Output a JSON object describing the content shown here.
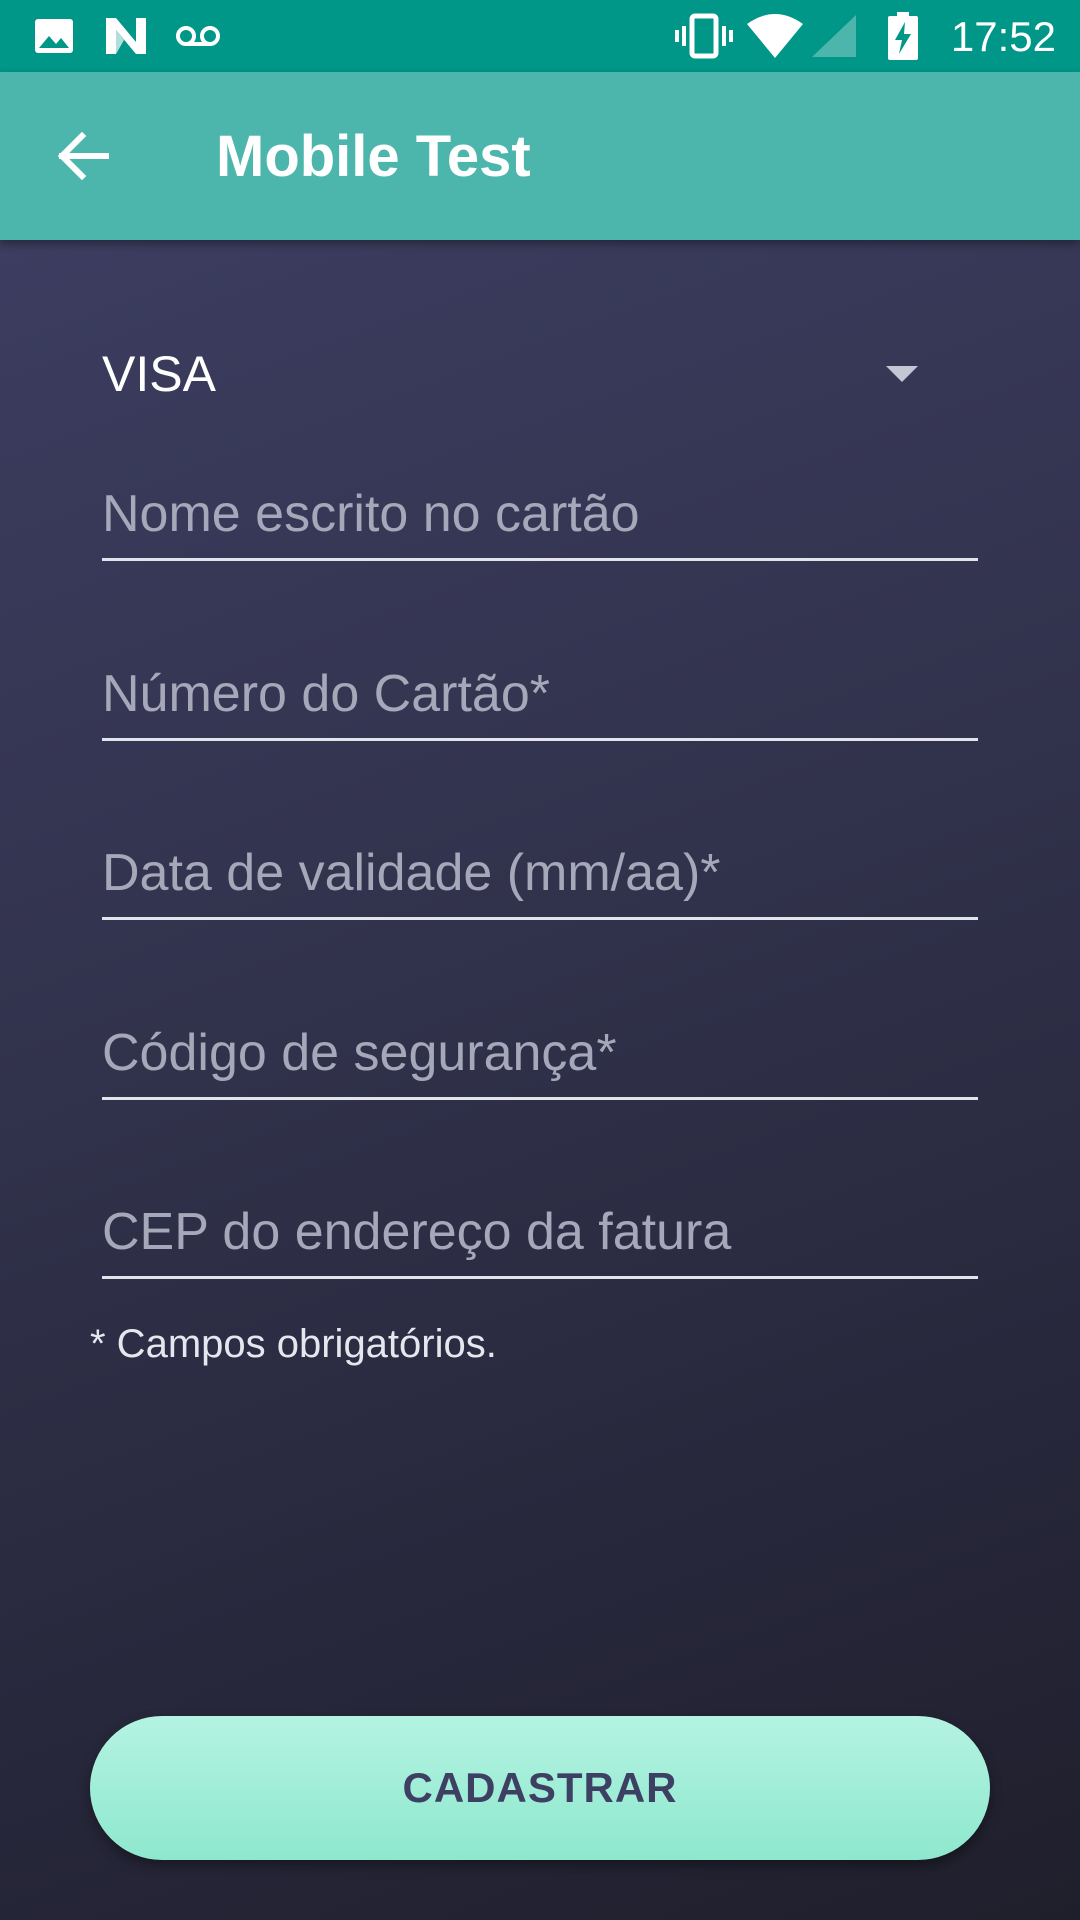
{
  "status_bar": {
    "time": "17:52",
    "left_icons": [
      "image-icon",
      "n-notification-icon",
      "voicemail-icon"
    ],
    "right_icons": [
      "vibrate-icon",
      "wifi-icon",
      "cell-signal-icon",
      "battery-charging-icon"
    ]
  },
  "app_bar": {
    "title": "Mobile Test",
    "back_icon": "arrow-back-icon"
  },
  "form": {
    "card_type": {
      "selected": "VISA",
      "icon": "dropdown-arrow-icon"
    },
    "fields": [
      {
        "placeholder": "Nome escrito no cartão",
        "value": ""
      },
      {
        "placeholder": "Número do Cartão*",
        "value": ""
      },
      {
        "placeholder": "Data de validade (mm/aa)*",
        "value": ""
      },
      {
        "placeholder": "Código de segurança*",
        "value": ""
      },
      {
        "placeholder": "CEP do endereço da fatura",
        "value": ""
      }
    ],
    "required_note": "* Campos obrigatórios.",
    "submit_label": "CADASTRAR"
  },
  "colors": {
    "status_bar": "#009688",
    "app_bar": "#4db6ac",
    "background_top": "#3c3d60",
    "background_bottom": "#1f1f2c",
    "button": "#9eedd6",
    "button_text": "#3e4063"
  }
}
